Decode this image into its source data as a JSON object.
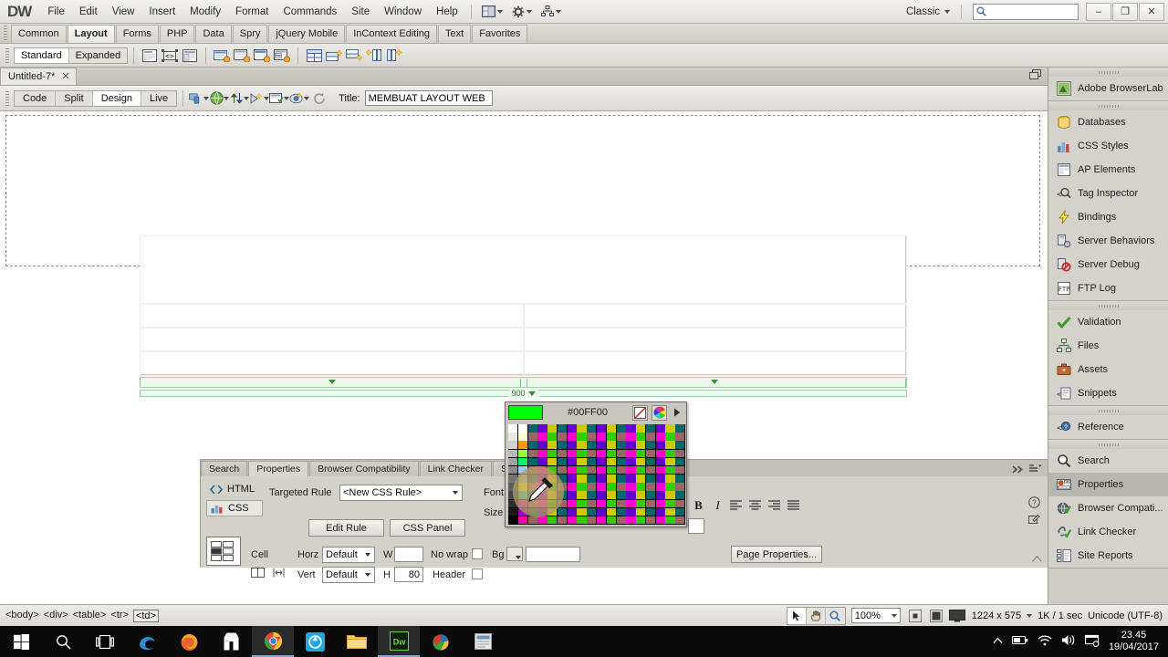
{
  "app": {
    "logo": "DW",
    "workspace": "Classic",
    "menus": [
      "File",
      "Edit",
      "View",
      "Insert",
      "Modify",
      "Format",
      "Commands",
      "Site",
      "Window",
      "Help"
    ],
    "search_placeholder": "",
    "search_value": "",
    "window_buttons": {
      "minimize": "–",
      "restore": "❐",
      "close": "✕"
    }
  },
  "insert_tabs": {
    "items": [
      "Common",
      "Layout",
      "Forms",
      "PHP",
      "Data",
      "Spry",
      "jQuery Mobile",
      "InContext Editing",
      "Text",
      "Favorites"
    ],
    "active": "Layout"
  },
  "layout_toolbar": {
    "modes": [
      "Standard",
      "Expanded"
    ],
    "active_mode": "Standard",
    "icons": [
      "insert-div-tag-icon",
      "draw-ap-div-icon",
      "spry-menu-bar-icon",
      "spry-tabbed-panels-icon",
      "spry-accordion-icon",
      "spry-collapsible-panel-icon",
      "spry-validation-icon",
      "insert-table-icon",
      "insert-row-above-icon",
      "insert-row-below-icon",
      "insert-column-left-icon",
      "insert-column-right-icon"
    ]
  },
  "document": {
    "tab_title": "Untitled-7*",
    "tab_close": "✕",
    "view_modes": [
      "Code",
      "Split",
      "Design",
      "Live"
    ],
    "active_view": "Design",
    "toolbar_icons": [
      "multiscreen-icon",
      "preview-browser-icon",
      "file-management-icon",
      "view-options-icon",
      "validate-markup-icon",
      "check-browser-icon",
      "refresh-icon"
    ],
    "title_label": "Title:",
    "title_value": "MEMBUAT LAYOUT WEB"
  },
  "canvas": {
    "table": {
      "rows": [
        {
          "cells": [
            {
              "colspan": 2,
              "header": true
            }
          ]
        },
        {
          "cells": [
            {
              "colspan": 1
            },
            {
              "colspan": 1
            }
          ]
        },
        {
          "cells": [
            {
              "colspan": 1
            },
            {
              "colspan": 1
            }
          ]
        },
        {
          "cells": [
            {
              "colspan": 1
            },
            {
              "colspan": 1
            }
          ]
        }
      ],
      "width_label": "900"
    }
  },
  "panels": {
    "groups": [
      {
        "items": [
          {
            "label": "Adobe BrowserLab",
            "icon": "browserlab-icon",
            "selected": false
          }
        ]
      },
      {
        "items": [
          {
            "label": "Databases",
            "icon": "databases-icon",
            "selected": false
          },
          {
            "label": "CSS Styles",
            "icon": "css-styles-icon",
            "selected": false
          },
          {
            "label": "AP Elements",
            "icon": "ap-elements-icon",
            "selected": false
          },
          {
            "label": "Tag Inspector",
            "icon": "tag-inspector-icon",
            "selected": false
          },
          {
            "label": "Bindings",
            "icon": "bindings-icon",
            "selected": false
          },
          {
            "label": "Server Behaviors",
            "icon": "server-behaviors-icon",
            "selected": false
          },
          {
            "label": "Server Debug",
            "icon": "server-debug-icon",
            "selected": false
          },
          {
            "label": "FTP Log",
            "icon": "ftp-log-icon",
            "selected": false
          }
        ]
      },
      {
        "items": [
          {
            "label": "Validation",
            "icon": "validation-icon",
            "selected": false
          },
          {
            "label": "Files",
            "icon": "files-icon",
            "selected": false
          },
          {
            "label": "Assets",
            "icon": "assets-icon",
            "selected": false
          },
          {
            "label": "Snippets",
            "icon": "snippets-icon",
            "selected": false
          }
        ]
      },
      {
        "items": [
          {
            "label": "Reference",
            "icon": "reference-icon",
            "selected": false
          }
        ]
      },
      {
        "items": [
          {
            "label": "Search",
            "icon": "search-icon",
            "selected": false
          },
          {
            "label": "Properties",
            "icon": "properties-icon",
            "selected": true
          },
          {
            "label": "Browser Compati...",
            "icon": "browser-compatibility-icon",
            "selected": false
          },
          {
            "label": "Link Checker",
            "icon": "link-checker-icon",
            "selected": false
          },
          {
            "label": "Site Reports",
            "icon": "site-reports-icon",
            "selected": false
          }
        ]
      }
    ]
  },
  "properties": {
    "tabs": [
      "Search",
      "Properties",
      "Browser Compatibility",
      "Link Checker",
      "Site Repor"
    ],
    "active_tab": "Properties",
    "html_label": "HTML",
    "css_label": "CSS",
    "active_mode": "CSS",
    "targeted_rule_label": "Targeted Rule",
    "targeted_rule_value": "<New CSS Rule>",
    "edit_rule_label": "Edit Rule",
    "css_panel_label": "CSS Panel",
    "font_label": "Font",
    "size_label": "Size",
    "bold_label": "B",
    "italic_label": "I",
    "align_icons": [
      "align-left-icon",
      "align-center-icon",
      "align-right-icon",
      "align-justify-icon"
    ],
    "cell_label": "Cell",
    "horz_label": "Horz",
    "horz_value": "Default",
    "vert_label": "Vert",
    "vert_value": "Default",
    "w_label": "W",
    "w_value": "",
    "h_label": "H",
    "h_value": "80",
    "nowrap_label": "No wrap",
    "header_label": "Header",
    "bg_label": "Bg",
    "bg_value": "",
    "page_properties_label": "Page Properties...",
    "help_icon": "help-icon",
    "expand_icon": "expand-panel-icon",
    "menu_icon": "panel-menu-icon"
  },
  "color_picker": {
    "hex": "#00FF00",
    "swatch_color": "#00FF00",
    "no_color_icon": "no-color-icon",
    "color_wheel_icon": "color-wheel-icon",
    "menu_arrow_icon": "picker-menu-arrow-icon",
    "cursor_icon": "eyedropper-icon"
  },
  "status_bar": {
    "tags": [
      "<body>",
      "<div>",
      "<table>",
      "<tr>",
      "<td>"
    ],
    "selected_tag": "<td>",
    "tools": [
      "select-tool-icon",
      "hand-tool-icon",
      "zoom-tool-icon"
    ],
    "active_tool": "select-tool-icon",
    "zoom": "100%",
    "window_sizes": [
      "small-screen-icon",
      "medium-screen-icon",
      "large-screen-icon"
    ],
    "dimensions": "1224 x 575",
    "download": "1K / 1 sec",
    "encoding": "Unicode (UTF-8)"
  },
  "taskbar": {
    "items": [
      {
        "icon": "windows-start-icon",
        "running": false
      },
      {
        "icon": "search-icon",
        "running": false
      },
      {
        "icon": "task-view-icon",
        "running": false
      },
      {
        "icon": "edge-browser-icon",
        "running": false
      },
      {
        "icon": "firefox-browser-icon",
        "running": false
      },
      {
        "icon": "microsoft-store-icon",
        "running": false
      },
      {
        "icon": "chrome-browser-icon",
        "running": true
      },
      {
        "icon": "blue-app-icon",
        "running": false
      },
      {
        "icon": "file-explorer-icon",
        "running": false
      },
      {
        "icon": "dreamweaver-icon",
        "running": true
      },
      {
        "icon": "photoshop-icon",
        "running": false
      },
      {
        "icon": "notepad-icon",
        "running": false
      }
    ],
    "tray": [
      "tray-chevron-icon",
      "battery-icon",
      "wifi-icon",
      "volume-icon",
      "action-center-icon"
    ],
    "time": "23.45",
    "date": "19/04/2017"
  }
}
